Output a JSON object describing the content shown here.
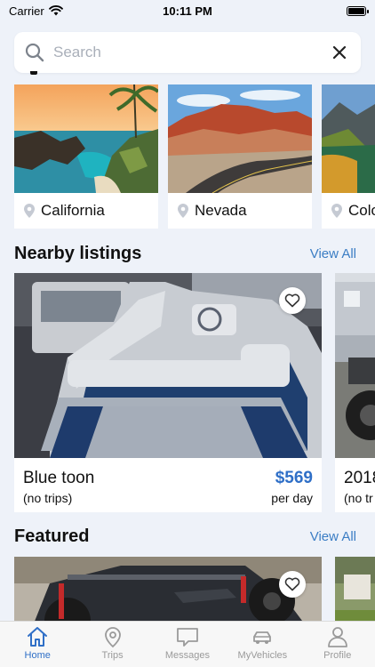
{
  "status_bar": {
    "carrier": "Carrier",
    "time": "10:11 PM"
  },
  "search": {
    "placeholder": "Search"
  },
  "destinations": [
    {
      "name": "California"
    },
    {
      "name": "Nevada"
    },
    {
      "name": "Colo"
    }
  ],
  "nearby": {
    "title": "Nearby listings",
    "view_all": "View All",
    "listings": [
      {
        "title": "Blue toon",
        "subtitle": "(no trips)",
        "price": "$569",
        "unit": "per day"
      },
      {
        "title": "2018",
        "subtitle": "(no tr"
      }
    ]
  },
  "featured": {
    "title": "Featured",
    "view_all": "View All"
  },
  "tabs": [
    {
      "label": "Home",
      "icon": "home-icon",
      "active": true
    },
    {
      "label": "Trips",
      "icon": "location-pin-icon"
    },
    {
      "label": "Messages",
      "icon": "message-icon"
    },
    {
      "label": "MyVehicles",
      "icon": "car-icon"
    },
    {
      "label": "Profile",
      "icon": "person-icon"
    }
  ],
  "colors": {
    "accent": "#2f6fc7",
    "link": "#3b7dc4",
    "background": "#eef2f9"
  }
}
